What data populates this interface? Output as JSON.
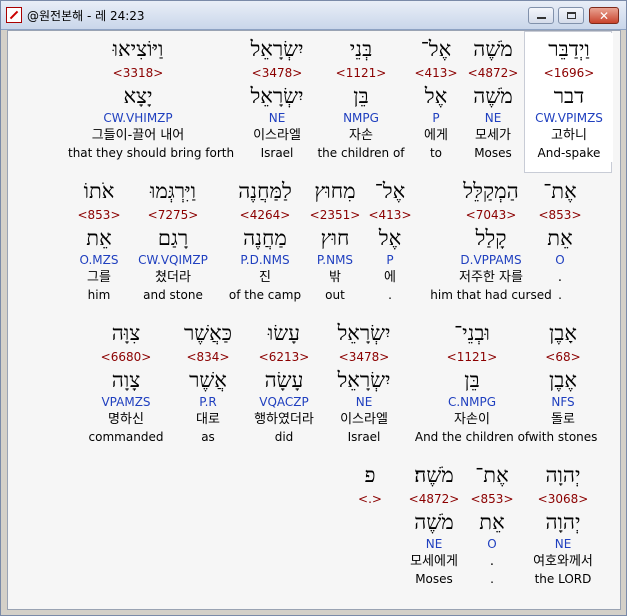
{
  "window": {
    "title": "@원전본해 - 레 24:23",
    "icon": "bible-app-icon"
  },
  "controls": {
    "minimize": "minimize-icon",
    "maximize": "maximize-icon",
    "close": "close-icon"
  },
  "rows": [
    [
      {
        "heb": "וַיְדַבֵּר",
        "num": "<1696>",
        "heb2": "דבר",
        "morph": "CW.VPIMZS",
        "kor": "고하니",
        "eng": "And-spake",
        "selected": true
      },
      {
        "heb": "מֹשֶׁה",
        "num": "<4872>",
        "heb2": "מֹשֶׁה",
        "morph": "NE",
        "kor": "모세가",
        "eng": "Moses"
      },
      {
        "heb": "אֶל־",
        "num": "<413>",
        "heb2": "אֶל",
        "morph": "P",
        "kor": "에게",
        "eng": "to"
      },
      {
        "heb": "בְּנֵי",
        "num": "<1121>",
        "heb2": "בֵּן",
        "morph": "NMPG",
        "kor": "자손",
        "eng": "the children of"
      },
      {
        "heb": "יִשְׂרָאֵל",
        "num": "<3478>",
        "heb2": "יִשְׂרָאֵל",
        "morph": "NE",
        "kor": "이스라엘",
        "eng": "Israel"
      },
      {
        "heb": "וַיּוֹצִיאוּ",
        "num": "<3318>",
        "heb2": "יָצָא",
        "morph": "CW.VHIMZP",
        "kor": "그들이-끌어 내어",
        "eng": "that they should bring forth"
      }
    ],
    [
      {
        "heb": "אֶת־",
        "num": "<853>",
        "heb2": "אֵת",
        "morph": "O",
        "kor": ".",
        "eng": "."
      },
      {
        "heb": "הַמְקַלֵּל",
        "num": "<7043>",
        "heb2": "קָלַל",
        "morph": "D.VPPAMS",
        "kor": "저주한 자를",
        "eng": "him that had cursed"
      },
      {
        "heb": "אֶל־",
        "num": "<413>",
        "heb2": "אֶל",
        "morph": "P",
        "kor": "에",
        "eng": "."
      },
      {
        "heb": "מִחוּץ",
        "num": "<2351>",
        "heb2": "חוּץ",
        "morph": "P.NMS",
        "kor": "밖",
        "eng": "out"
      },
      {
        "heb": "לַמַּחֲנֶה",
        "num": "<4264>",
        "heb2": "מַחֲנֶה",
        "morph": "P.D.NMS",
        "kor": "진",
        "eng": "of the camp"
      },
      {
        "heb": "וַיִּרְגְּמוּ",
        "num": "<7275>",
        "heb2": "רָגַם",
        "morph": "CW.VQIMZP",
        "kor": "쳤더라",
        "eng": "and stone"
      },
      {
        "heb": "אֹתוֹ",
        "num": "<853>",
        "heb2": "אֵת",
        "morph": "O.MZS",
        "kor": "그를",
        "eng": "him"
      }
    ],
    [
      {
        "heb": "אָבֶן",
        "num": "<68>",
        "heb2": "אֶבֶן",
        "morph": "NFS",
        "kor": "돌로",
        "eng": "with stones"
      },
      {
        "heb": "וּבְנֵי־",
        "num": "<1121>",
        "heb2": "בֵּן",
        "morph": "C.NMPG",
        "kor": "자손이",
        "eng": "And the children of"
      },
      {
        "heb": "יִשְׂרָאֵל",
        "num": "<3478>",
        "heb2": "יִשְׂרָאֵל",
        "morph": "NE",
        "kor": "이스라엘",
        "eng": "Israel"
      },
      {
        "heb": "עָשׂוּ",
        "num": "<6213>",
        "heb2": "עָשָׂה",
        "morph": "VQACZP",
        "kor": "행하였더라",
        "eng": "did"
      },
      {
        "heb": "כַּאֲשֶׁר",
        "num": "<834>",
        "heb2": "אֲשֶׁר",
        "morph": "P.R",
        "kor": "대로",
        "eng": "as"
      },
      {
        "heb": "צִוָּה",
        "num": "<6680>",
        "heb2": "צָוָה",
        "morph": "VPAMZS",
        "kor": "명하신",
        "eng": "commanded"
      }
    ],
    [
      {
        "heb": "יְהוָה",
        "num": "<3068>",
        "heb2": "יְהוָה",
        "morph": "NE",
        "kor": "여호와께서",
        "eng": "the LORD"
      },
      {
        "heb": "אֶת־",
        "num": "<853>",
        "heb2": "אֵת",
        "morph": "O",
        "kor": ".",
        "eng": "."
      },
      {
        "heb": "מֹשֶׁה׃",
        "num": "<4872>",
        "heb2": "מֹשֶׁה",
        "morph": "NE",
        "kor": "모세에게",
        "eng": "Moses"
      },
      {
        "heb": "פ",
        "num": "<.>",
        "heb2": "",
        "morph": "",
        "kor": "",
        "eng": ""
      }
    ]
  ]
}
